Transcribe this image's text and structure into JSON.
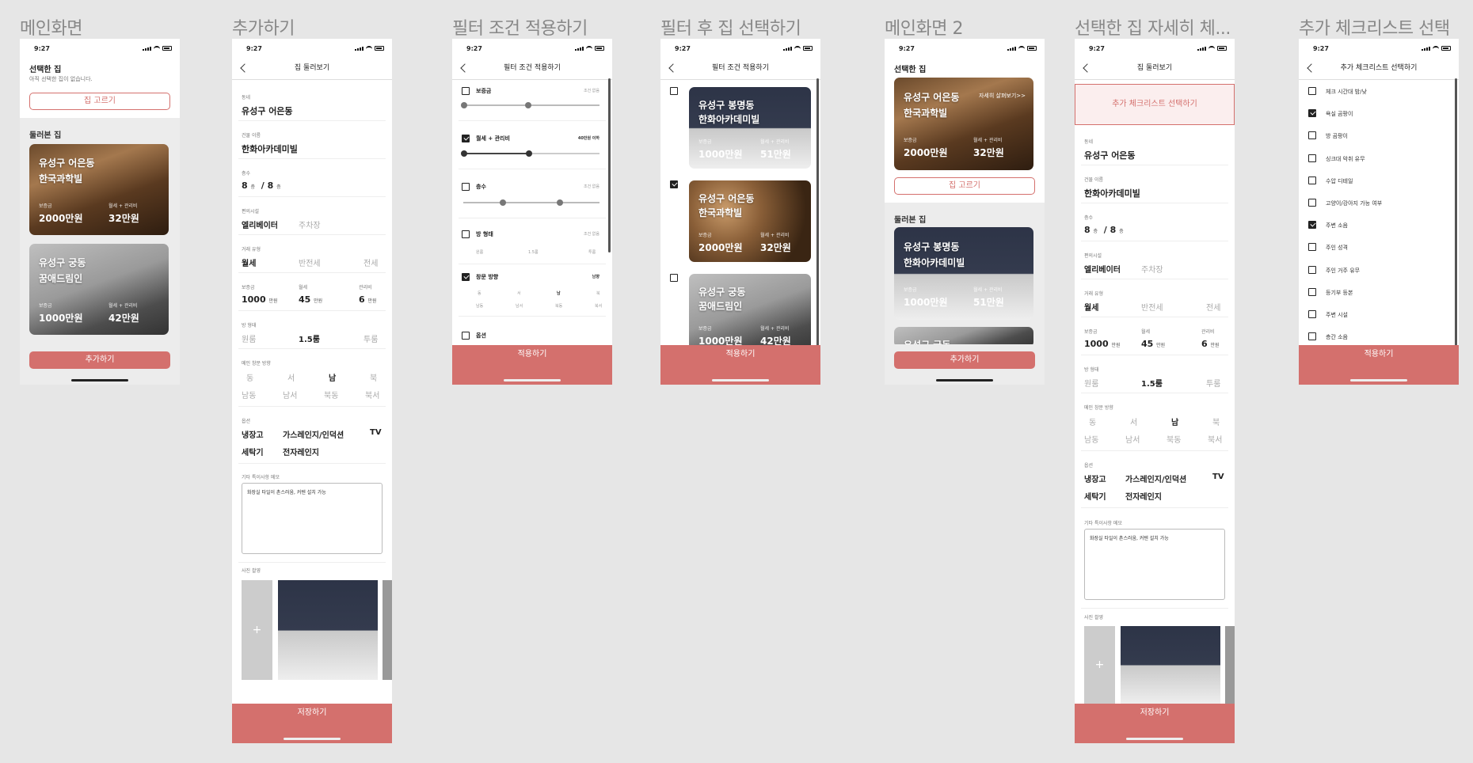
{
  "status": {
    "time": "9:27"
  },
  "frame_titles": [
    "메인화면",
    "추가하기",
    "필터 조건 적용하기",
    "필터 후 집 선택하기",
    "메인화면 2",
    "선택한 집 자세히 체...",
    "추가 체크리스트 선택"
  ],
  "main": {
    "selected_label": "선택한 집",
    "empty_msg": "아직 선택한 집이 없습니다.",
    "select_btn": "집 고르기",
    "visited_label": "둘러본 집",
    "add_btn": "추가하기"
  },
  "cards": [
    {
      "line1": "유성구 어은동",
      "line2": "한국과학빌",
      "deposit_label": "보증금",
      "deposit": "2000만원",
      "rent_label": "월세 + 관리비",
      "rent": "32만원"
    },
    {
      "line1": "유성구 궁동",
      "line2": "꿈애드림인",
      "deposit_label": "보증금",
      "deposit": "1000만원",
      "rent_label": "월세 + 관리비",
      "rent": "42만원"
    },
    {
      "line1": "유성구 봉명동",
      "line2": "한화아카데미빌",
      "deposit_label": "보증금",
      "deposit": "1000만원",
      "rent_label": "월세 + 관리비",
      "rent": "51만원"
    }
  ],
  "add": {
    "nav_title": "집 둘러보기",
    "dong_label": "동네",
    "dong": "유성구 어은동",
    "bldg_label": "건물 이름",
    "bldg": "한화아카데미빌",
    "floor_label": "층수",
    "floor_a": "8",
    "floor_unit": "층",
    "floor_sep": "/",
    "floor_b": "8",
    "amen_label": "편의시설",
    "amen_on": "엘리베이터",
    "amen_off": "주차장",
    "deal_label": "거래 유형",
    "deal_on": "월세",
    "deal_mid": "반전세",
    "deal_off": "전세",
    "dep_label": "보증금",
    "dep": "1000",
    "rent_label": "월세",
    "rent": "45",
    "mgmt_label": "관리비",
    "mgmt": "6",
    "won": "만원",
    "room_label": "방 형태",
    "room_a": "원룸",
    "room_b": "1.5룸",
    "room_c": "투룸",
    "dir_label": "메인 창문 방향",
    "dirs": [
      "동",
      "서",
      "남",
      "북",
      "남동",
      "남서",
      "북동",
      "북서"
    ],
    "opt_label": "옵션",
    "opts": [
      "냉장고",
      "가스레인지/인덕션",
      "TV",
      "세탁기",
      "전자레인지"
    ],
    "memo_label": "기타 특이사항 메모",
    "memo": "화장실 타일이 촌스러움, 커텐 설치 가능",
    "photo_label": "사진 촬영",
    "plus": "+",
    "save_btn": "저장하기"
  },
  "filter": {
    "nav_title": "필터 조건 적용하기",
    "deposit": "보증금",
    "rent": "월세 + 관리비",
    "rent_val": "40만원 이하",
    "floor": "층수",
    "room": "방 형태",
    "window": "창문 방향",
    "window_val": "남향",
    "option": "옵션",
    "none": "조건 없음",
    "room_ticks": [
      "원룸",
      "1.5룸",
      "투룸"
    ],
    "dir_row1": [
      "동",
      "서",
      "남",
      "북"
    ],
    "dir_row2": [
      "남동",
      "남서",
      "북동",
      "북서"
    ],
    "apply_btn": "적용하기"
  },
  "select2": {
    "nav_title": "필터 조건 적용하기",
    "apply_btn": "적용하기"
  },
  "main2": {
    "selected_label": "선택한 집",
    "detail_link": "자세히 살펴보기>>",
    "select_btn": "집 고르기",
    "visited_label": "둘러본 집",
    "add_btn": "추가하기",
    "partial": "유성구 궁동"
  },
  "detail": {
    "nav_title": "집 둘러보기",
    "checklist_btn": "추가 체크리스트 선택하기"
  },
  "checklist": {
    "nav_title": "추가 체크리스트 선택하기",
    "items": [
      "체크 시간대 밤/낮",
      "욕실 곰팡이",
      "방 곰팡이",
      "싱크대 악취 유무",
      "수압 디테일",
      "고양이/강아지 가능 여부",
      "주변 소음",
      "주인 성격",
      "주인 거주 유무",
      "등기부 등본",
      "주변 시설",
      "층간 소음"
    ],
    "checked": [
      false,
      true,
      false,
      false,
      false,
      false,
      true,
      false,
      false,
      false,
      false,
      false
    ],
    "apply_btn": "적용하기"
  },
  "colors": {
    "accent": "#d4706d",
    "background": "#e6e6e6"
  }
}
